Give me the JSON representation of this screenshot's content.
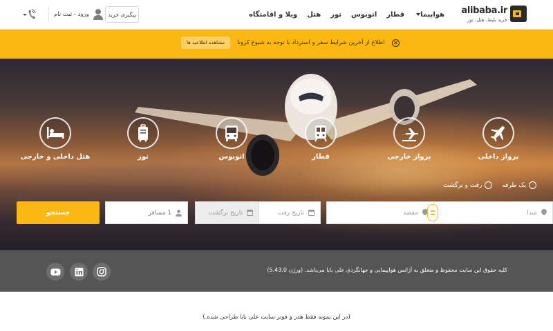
{
  "header": {
    "logo_text": "alibaba.ir",
    "logo_sub": "خرید بلیط، هتل، تور",
    "nav": [
      {
        "label": "هواپیما",
        "has_caret": true
      },
      {
        "label": "قطار"
      },
      {
        "label": "اتوبوس"
      },
      {
        "label": "تور"
      },
      {
        "label": "هتل"
      },
      {
        "label": "ویلا و اقامتگاه"
      }
    ],
    "track_label": "پیگیری خرید",
    "login_label": "ورود - ثبت نام"
  },
  "notice": {
    "text": "اطلاع از آخرین شرایط سفر و استرداد با توجه به شیوع کرونا",
    "button_label": "مشاهده اطلاعیه ها"
  },
  "services": [
    {
      "label": "پرواز داخلی",
      "icon": "domestic-flight-icon"
    },
    {
      "label": "پرواز خارجی",
      "icon": "international-flight-icon"
    },
    {
      "label": "قطار",
      "icon": "train-icon"
    },
    {
      "label": "اتوبوس",
      "icon": "bus-icon"
    },
    {
      "label": "تور",
      "icon": "tour-icon"
    },
    {
      "label": "هتل داخلی و خارجی",
      "icon": "hotel-icon"
    }
  ],
  "trip_type": {
    "one_way": "یک طرفه",
    "round_trip": "رفت و برگشت"
  },
  "search": {
    "origin_placeholder": "مبدا",
    "destination_placeholder": "مقصد",
    "depart_placeholder": "تاریخ رفت",
    "return_placeholder": "تاریخ برگشت",
    "passengers": "1 مسافر",
    "button_label": "جستجو"
  },
  "footer": {
    "copyright": "کلیه حقوق این سایت محفوظ و متعلق به آژانس هواپیمایی و جهانگردی علی بابا می‌باشد. (ورژن 5.43.0)"
  },
  "note": "(در این نمونه فقط هدر و فوتر سایت علی بابا طراحی شده.)",
  "colors": {
    "accent": "#fdb713",
    "footer": "#555555"
  }
}
